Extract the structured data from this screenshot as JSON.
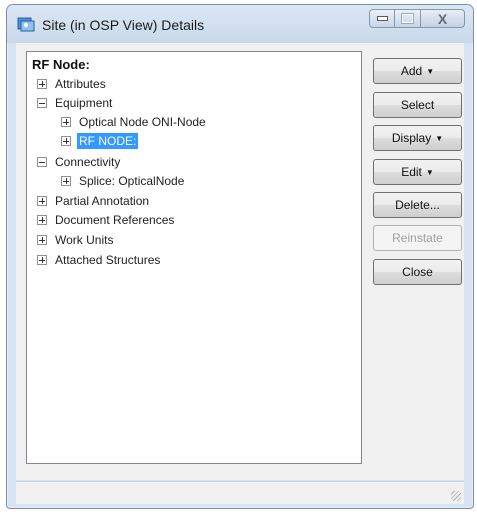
{
  "window": {
    "title": "Site (in OSP View) Details",
    "controls": {
      "minimize": "minimize",
      "maximize": "maximize",
      "close": "X"
    }
  },
  "tree": {
    "root_label": "RF Node:",
    "items": [
      {
        "label": "Attributes",
        "expanded": false,
        "level": 0
      },
      {
        "label": "Equipment",
        "expanded": true,
        "level": 0
      },
      {
        "label": "Optical Node ONI-Node",
        "expanded": false,
        "level": 1
      },
      {
        "label": "RF NODE:",
        "expanded": false,
        "level": 1,
        "selected": true
      },
      {
        "label": "Connectivity",
        "expanded": true,
        "level": 0
      },
      {
        "label": "Splice: OpticalNode",
        "expanded": false,
        "level": 1
      },
      {
        "label": "Partial Annotation",
        "expanded": false,
        "level": 0
      },
      {
        "label": "Document References",
        "expanded": false,
        "level": 0
      },
      {
        "label": "Work Units",
        "expanded": false,
        "level": 0
      },
      {
        "label": "Attached Structures",
        "expanded": false,
        "level": 0
      }
    ]
  },
  "buttons": {
    "add": {
      "label": "Add",
      "has_menu": true
    },
    "select": {
      "label": "Select"
    },
    "display": {
      "label": "Display",
      "has_menu": true
    },
    "edit": {
      "label": "Edit",
      "has_menu": true
    },
    "delete": {
      "label": "Delete..."
    },
    "reinstate": {
      "label": "Reinstate",
      "enabled": false
    },
    "close": {
      "label": "Close"
    }
  },
  "colors": {
    "selection": "#3399ff",
    "title_bar": "#c9d9ec"
  }
}
